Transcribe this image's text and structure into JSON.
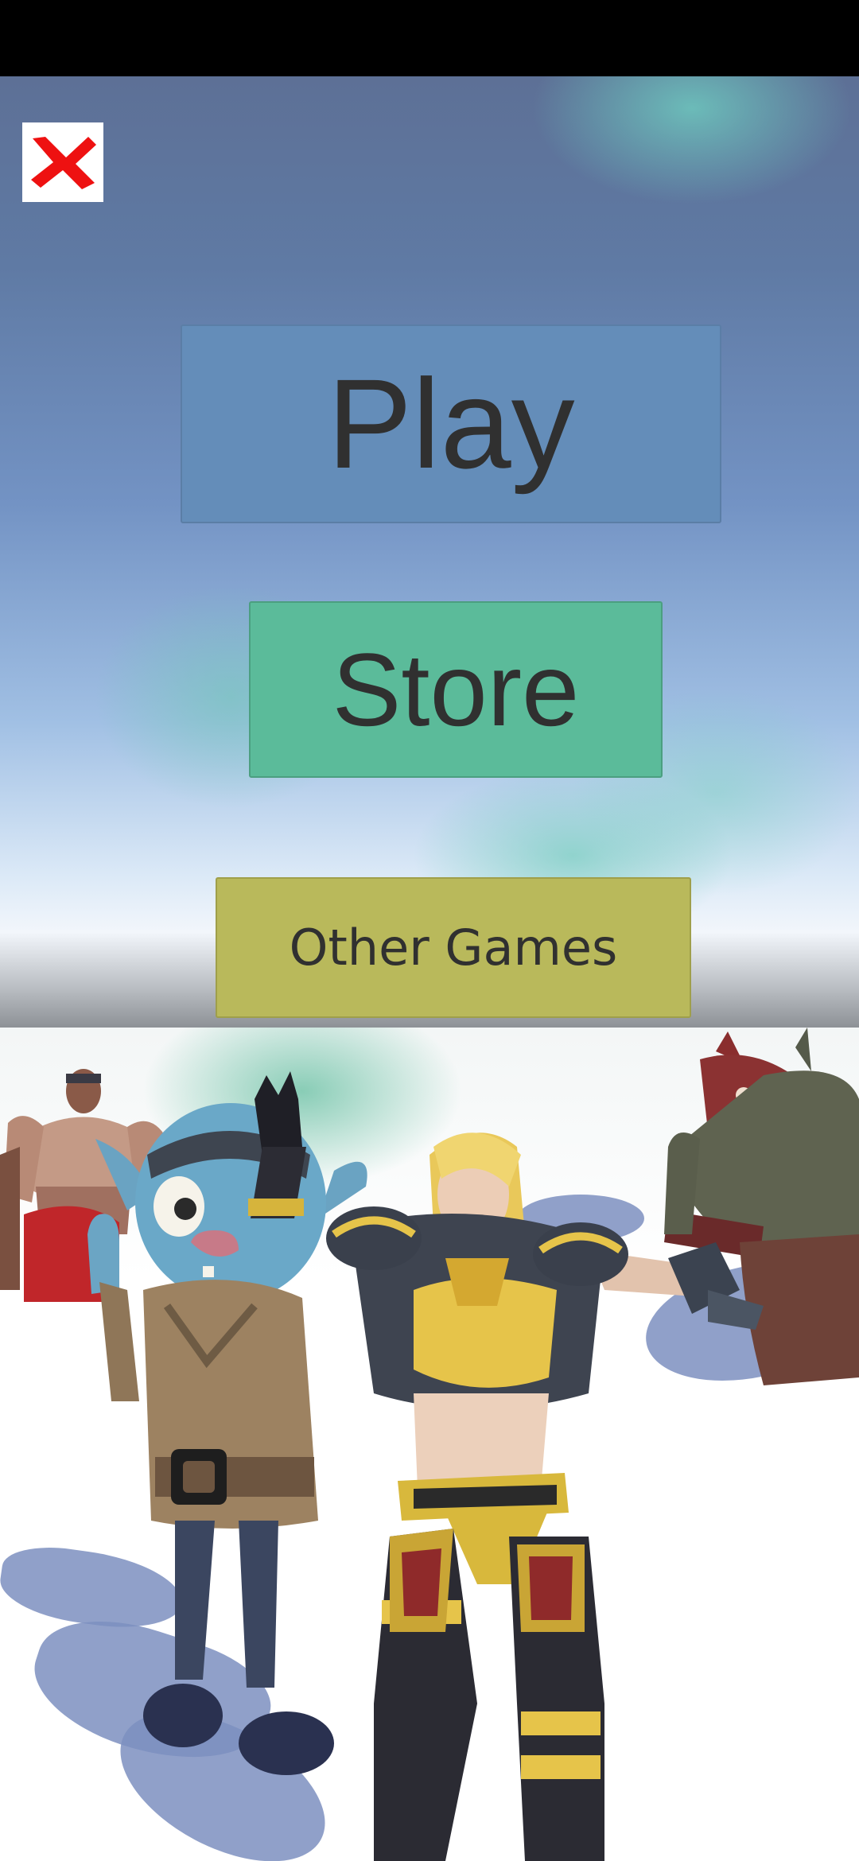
{
  "menu": {
    "play_label": "Play",
    "store_label": "Store",
    "other_games_label": "Other Games"
  },
  "icons": {
    "close": "close-icon"
  },
  "colors": {
    "status_bar": "#000000",
    "play_button": "#648db9",
    "store_button": "#5bbb9a",
    "other_games_button": "#b9b95b",
    "close_x": "#ee1111",
    "button_text": "#303030"
  },
  "scene": {
    "characters": [
      "muscular-zombie-character",
      "blue-goblin-character",
      "armored-warrior-woman-character",
      "horned-demon-character"
    ]
  }
}
